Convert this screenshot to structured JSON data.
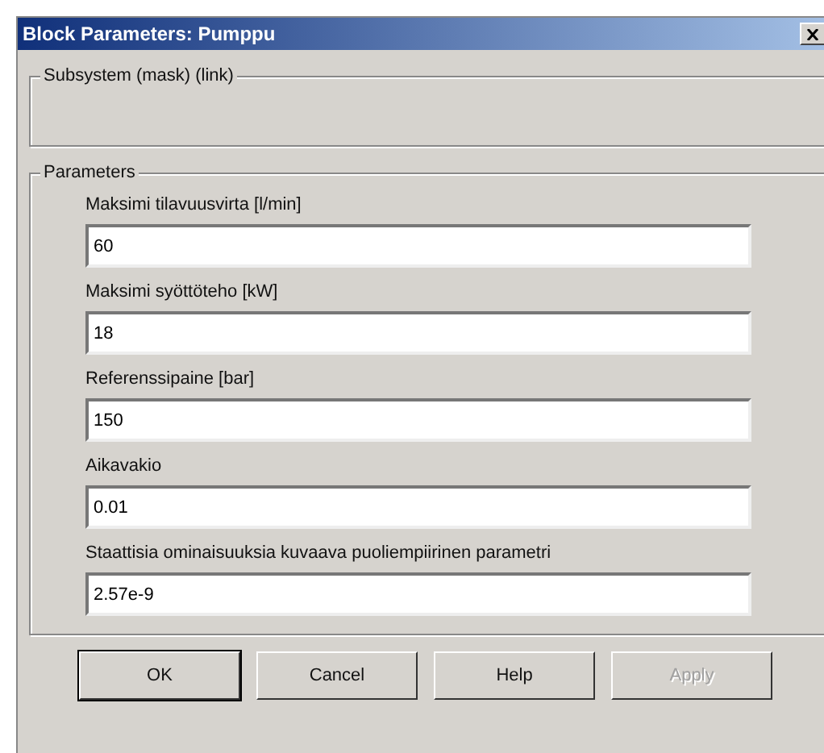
{
  "window": {
    "title": "Block Parameters: Pumppu"
  },
  "subsystem": {
    "legend": "Subsystem (mask) (link)"
  },
  "parameters": {
    "legend": "Parameters",
    "fields": [
      {
        "label": "Maksimi tilavuusvirta [l/min]",
        "value": "60"
      },
      {
        "label": "Maksimi syöttöteho [kW]",
        "value": "18"
      },
      {
        "label": "Referenssipaine [bar]",
        "value": "150"
      },
      {
        "label": "Aikavakio",
        "value": "0.01"
      },
      {
        "label": "Staattisia ominaisuuksia kuvaava puoliempiirinen parametri",
        "value": "2.57e-9"
      }
    ]
  },
  "buttons": [
    {
      "label": "OK",
      "default": true,
      "disabled": false
    },
    {
      "label": "Cancel",
      "default": false,
      "disabled": false
    },
    {
      "label": "Help",
      "default": false,
      "disabled": false
    },
    {
      "label": "Apply",
      "default": false,
      "disabled": true
    }
  ]
}
